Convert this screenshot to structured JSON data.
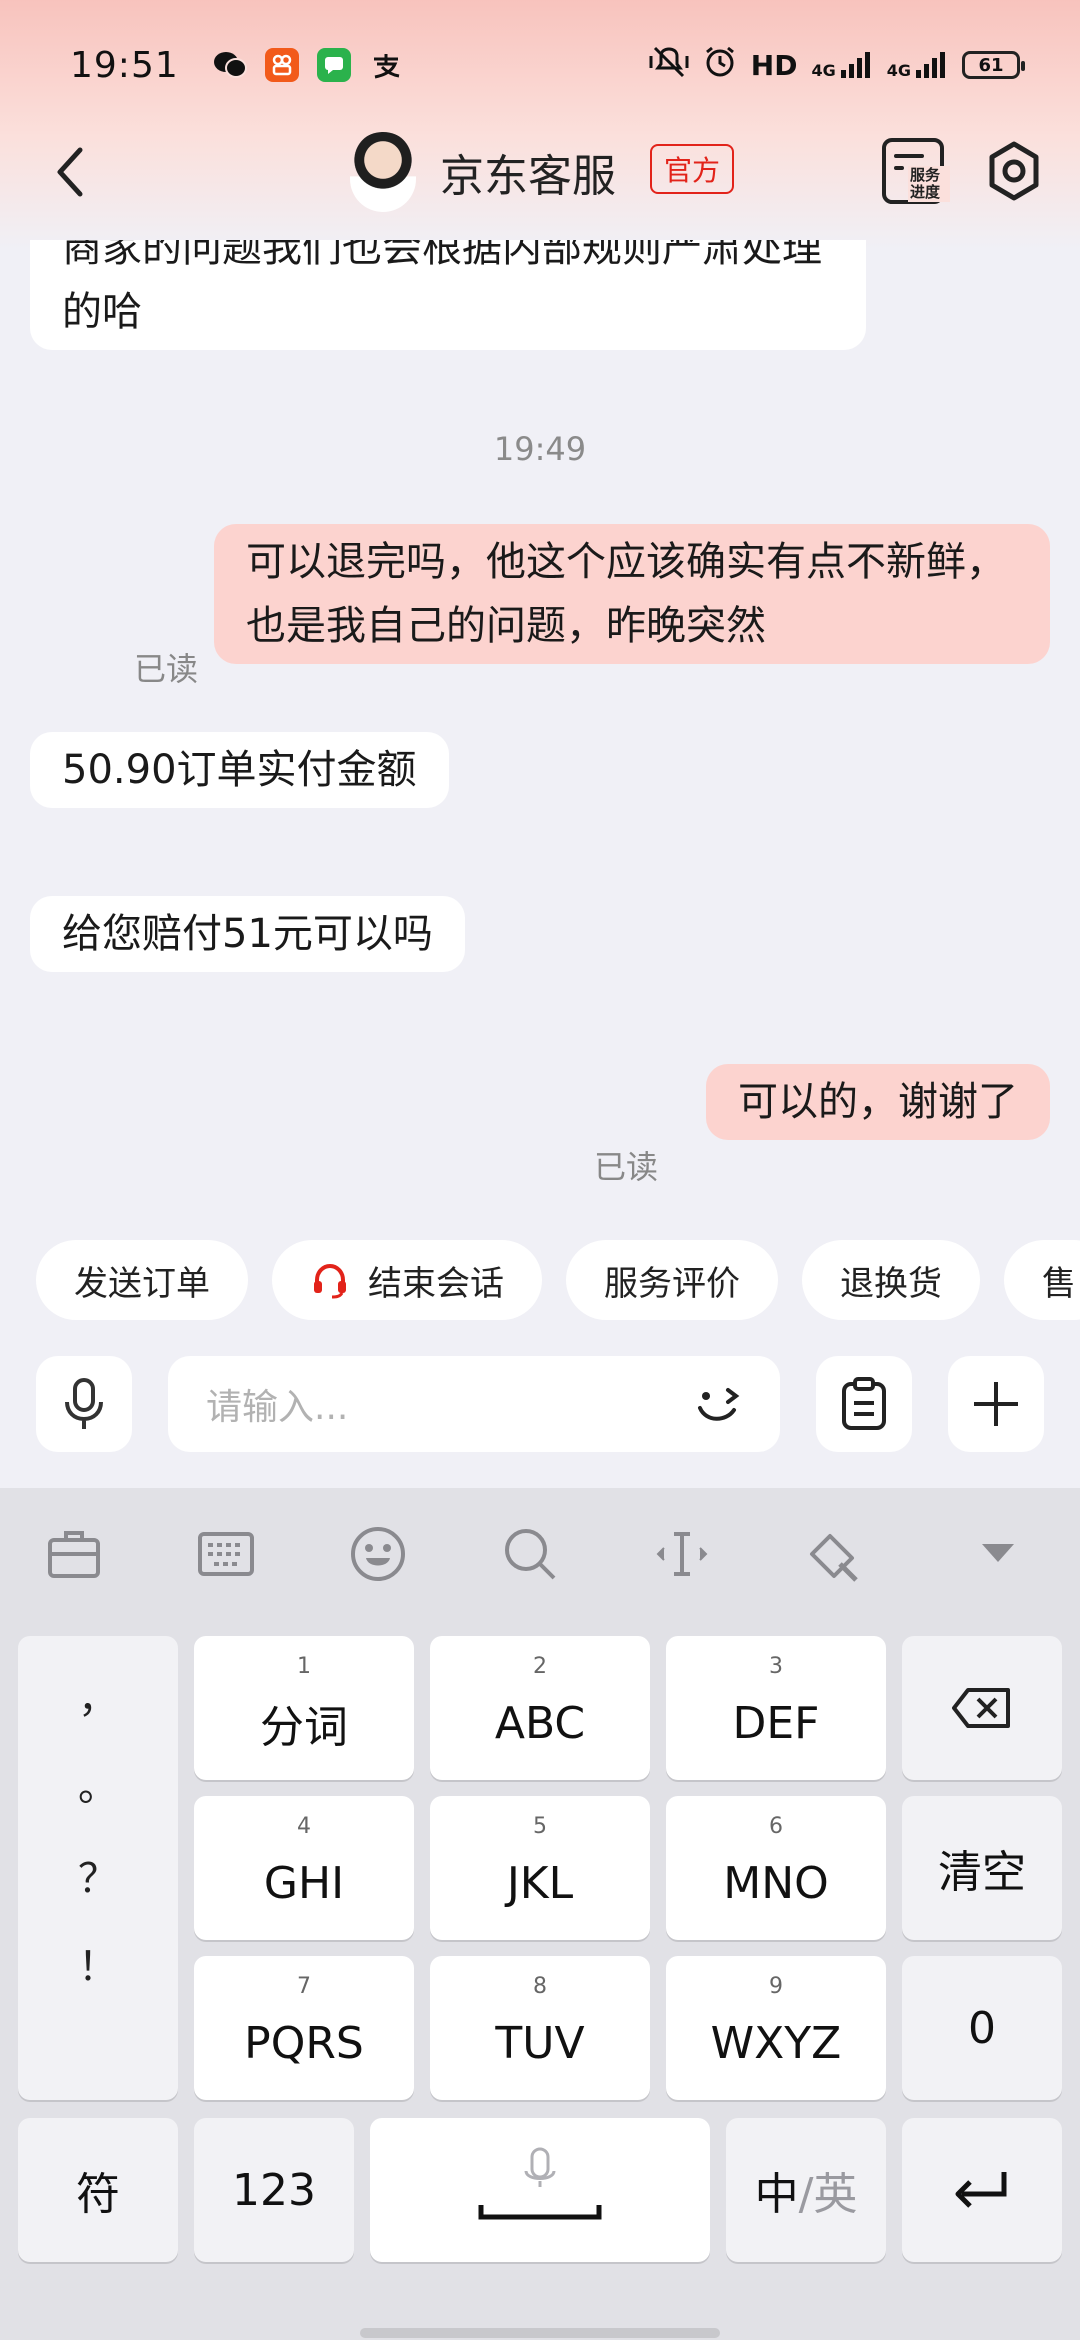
{
  "status_bar": {
    "time": "19:51",
    "network_hd": "HD",
    "network_1": "4G",
    "network_2": "4G",
    "battery": "61",
    "app_icons": [
      "wechat-icon",
      "video-app-icon",
      "message-icon",
      "alipay-icon"
    ],
    "status_icons": [
      "mute-vibrate-icon",
      "alarm-icon",
      "hd-icon",
      "signal-icon",
      "signal-icon",
      "battery-icon"
    ]
  },
  "header": {
    "title": "京东客服",
    "badge": "官方",
    "service_progress_label": "服务进度"
  },
  "chat": {
    "messages": [
      {
        "side": "left",
        "text": "商家的问题我们也会根据内部规则严肃处理的哈"
      },
      {
        "type": "timestamp",
        "text": "19:49"
      },
      {
        "side": "right",
        "text": "可以退完吗，他这个应该确实有点不新鲜，也是我自己的问题，昨晚突然",
        "status": "已读"
      },
      {
        "side": "left",
        "text": "50.90订单实付金额"
      },
      {
        "side": "left",
        "text": "给您赔付51元可以吗"
      },
      {
        "side": "right",
        "text": "可以的，谢谢了",
        "status": "已读"
      }
    ]
  },
  "quick_actions": [
    "发送订单",
    "结束会话",
    "服务评价",
    "退换货",
    "售"
  ],
  "input": {
    "placeholder": "请输入..."
  },
  "keyboard": {
    "punctuation": [
      "，",
      "。",
      "？",
      "！"
    ],
    "keys": [
      {
        "num": "1",
        "label": "分词"
      },
      {
        "num": "2",
        "label": "ABC"
      },
      {
        "num": "3",
        "label": "DEF"
      },
      {
        "num": "4",
        "label": "GHI"
      },
      {
        "num": "5",
        "label": "JKL"
      },
      {
        "num": "6",
        "label": "MNO"
      },
      {
        "num": "7",
        "label": "PQRS"
      },
      {
        "num": "8",
        "label": "TUV"
      },
      {
        "num": "9",
        "label": "WXYZ"
      }
    ],
    "clear": "清空",
    "zero": "0",
    "symbols": "符",
    "numbers": "123",
    "lang_zh": "中",
    "lang_en": "/英"
  }
}
